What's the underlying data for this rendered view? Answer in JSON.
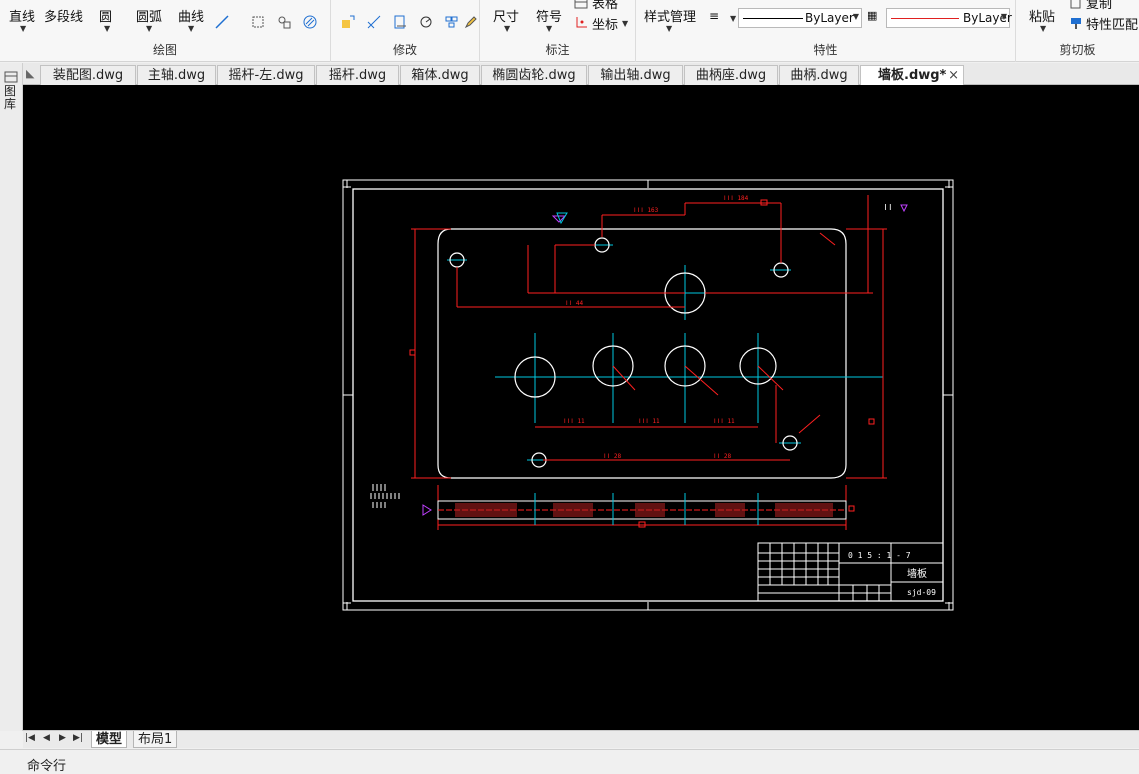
{
  "ribbon": {
    "draw": {
      "line": "直线",
      "polyline": "多段线",
      "circle": "圆",
      "arc": "圆弧",
      "curve": "曲线",
      "group_label": "绘图"
    },
    "modify": {
      "group_label": "修改"
    },
    "annotate": {
      "dimension": "尺寸",
      "symbol": "符号",
      "table": "表格",
      "coordinate": "坐标",
      "group_label": "标注"
    },
    "properties": {
      "style_manager": "样式管理",
      "linetype": "ByLayer",
      "color": "ByLayer",
      "group_label": "特性"
    },
    "clipboard": {
      "paste": "粘贴",
      "copy": "复制",
      "match_properties": "特性匹配",
      "group_label": "剪切板"
    },
    "colors": {
      "line_color": "#000000",
      "color_line": "#e02020"
    }
  },
  "tabs": [
    {
      "label": "装配图.dwg"
    },
    {
      "label": "主轴.dwg"
    },
    {
      "label": "摇杆-左.dwg"
    },
    {
      "label": "摇杆.dwg"
    },
    {
      "label": "箱体.dwg"
    },
    {
      "label": "椭圆齿轮.dwg"
    },
    {
      "label": "输出轴.dwg"
    },
    {
      "label": "曲柄座.dwg"
    },
    {
      "label": "曲柄.dwg"
    },
    {
      "label": "墙板.dwg*",
      "active": true
    }
  ],
  "tab_close": "×",
  "left_panel": {
    "label": "图库"
  },
  "drawing": {
    "title_block": {
      "code": "sjd-09",
      "name": "墙板",
      "scale": "0 1 5 : 1 - 7"
    },
    "colors": {
      "frame": "#ffffff",
      "dimension": "#ff2020",
      "centerline": "#00c8e0",
      "hatch": "#ff2020",
      "marker": "#c040ff"
    }
  },
  "layout_tabs": {
    "model": "模型",
    "layout1": "布局1"
  },
  "command_line": {
    "label": "命令行"
  }
}
